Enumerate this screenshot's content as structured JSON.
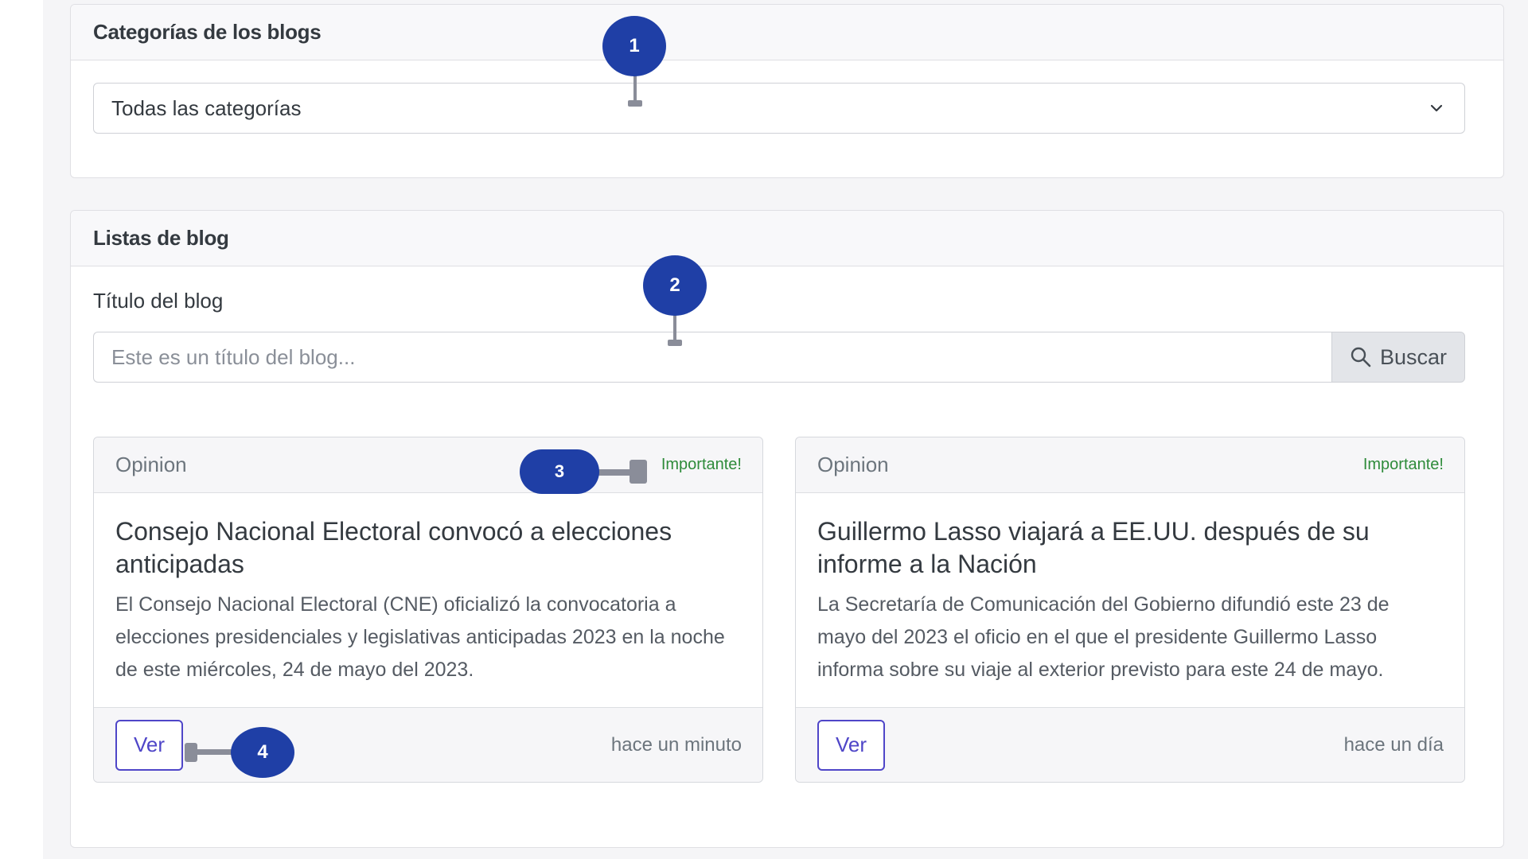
{
  "categories_card": {
    "title": "Categorías de los blogs",
    "select_value": "Todas las categorías"
  },
  "blogs_card": {
    "title": "Listas de blog",
    "title_label": "Título del blog",
    "search_placeholder": "Este es un título del blog...",
    "search_button": "Buscar"
  },
  "blogs": [
    {
      "category": "Opinion",
      "badge": "Importante!",
      "title": "Consejo Nacional Electoral convocó a elecciones anticipadas",
      "excerpt": "El Consejo Nacional Electoral (CNE) oficializó la convocatoria a elecciones presidenciales y legislativas anticipadas 2023 en la noche de este miércoles, 24 de mayo del 2023.",
      "button": "Ver",
      "time": "hace un minuto"
    },
    {
      "category": "Opinion",
      "badge": "Importante!",
      "title": "Guillermo Lasso viajará a EE.UU. después de su informe a la Nación",
      "excerpt": "La Secretaría de Comunicación del Gobierno difundió este 23 de mayo del 2023 el oficio en el que el presidente Guillermo Lasso informa sobre su viaje al exterior previsto para este 24 de mayo.",
      "button": "Ver",
      "time": "hace un día"
    }
  ],
  "markers": [
    "1",
    "2",
    "3",
    "4"
  ],
  "colors": {
    "marker": "#1f3fa6",
    "badge_green": "#2e8b3a",
    "primary_outline": "#4f46c8"
  },
  "icons": {
    "select": "chevron-down-icon",
    "search": "search-icon"
  }
}
